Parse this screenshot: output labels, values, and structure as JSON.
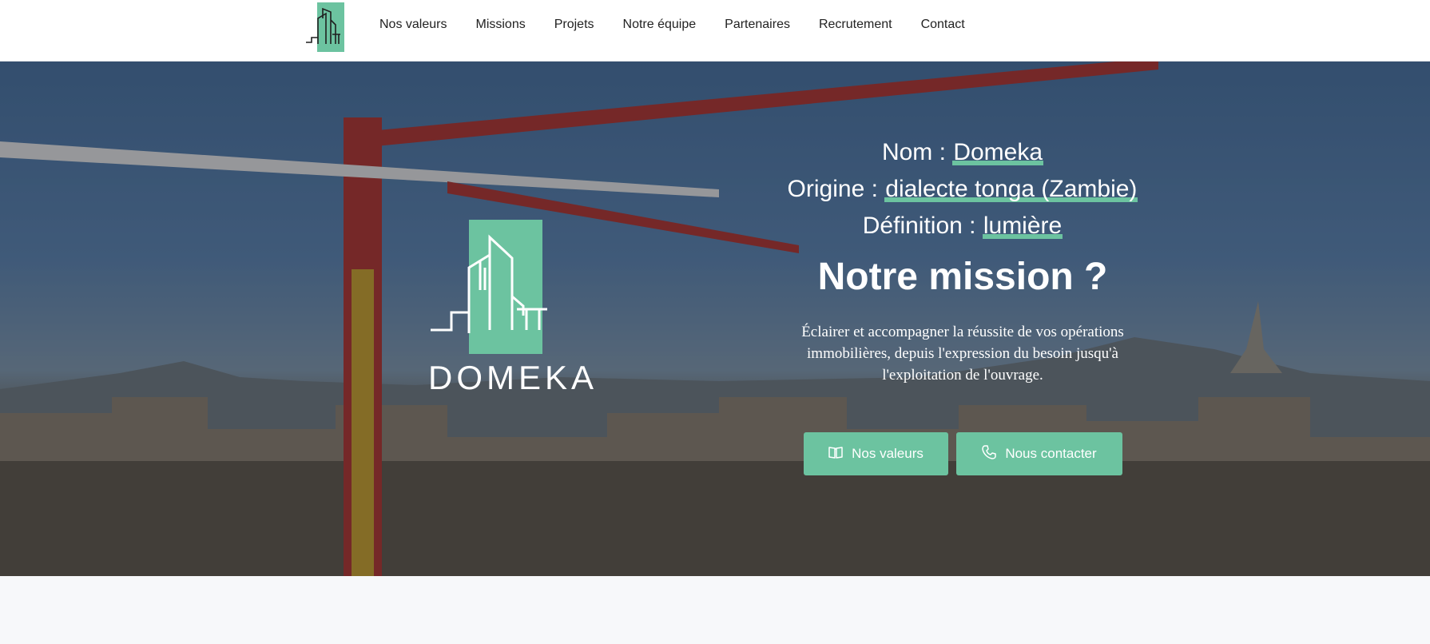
{
  "header": {
    "logo_icon": "domeka-building-logo-icon",
    "nav": [
      {
        "label": "Nos valeurs"
      },
      {
        "label": "Missions"
      },
      {
        "label": "Projets"
      },
      {
        "label": "Notre équipe"
      },
      {
        "label": "Partenaires"
      },
      {
        "label": "Recrutement"
      },
      {
        "label": "Contact"
      }
    ]
  },
  "hero": {
    "logo_word": "DOMEKA",
    "name_label": "Nom : ",
    "name_value": "Domeka",
    "origin_label": "Origine : ",
    "origin_value": "dialecte tonga (Zambie)",
    "definition_label": "Définition : ",
    "definition_value": "lumière",
    "mission_title": "Notre mission ?",
    "mission_text": "Éclairer et accompagner la réussite de vos opérations immobilières, depuis l'expression du besoin jusqu'à l'exploitation de l'ouvrage.",
    "buttons": {
      "values_label": "Nos valeurs",
      "values_icon": "open-book-icon",
      "contact_label": "Nous contacter",
      "contact_icon": "phone-icon"
    }
  },
  "colors": {
    "accent": "#6cc3a0",
    "header_bg": "#ffffff",
    "hero_overlay": "#14182060"
  }
}
